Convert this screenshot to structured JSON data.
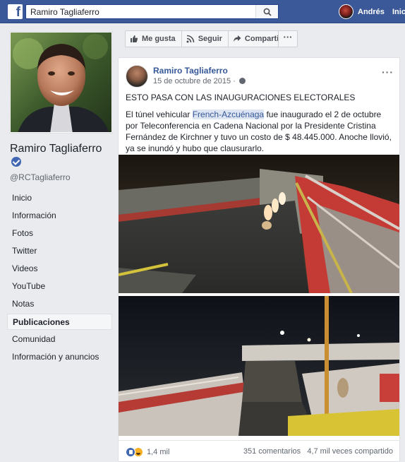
{
  "topbar": {
    "logo": "f",
    "search_value": "Ramiro Tagliaferro",
    "search_icon": "search-icon",
    "user_name": "Andrés",
    "home_label": "Inicio"
  },
  "page": {
    "name": "Ramiro Tagliaferro",
    "handle": "@RCTagliaferro",
    "nav": [
      "Inicio",
      "Información",
      "Fotos",
      "Twitter",
      "Videos",
      "YouTube",
      "Notas",
      "Publicaciones",
      "Comunidad",
      "Información y anuncios"
    ],
    "active_nav": "Publicaciones"
  },
  "actions": {
    "like": "Me gusta",
    "follow": "Seguir",
    "share": "Compartir",
    "more": "···"
  },
  "post": {
    "author": "Ramiro Tagliaferro",
    "date": "15 de octubre de 2015 ·",
    "menu": "···",
    "headline": "ESTO PASA CON LAS INAUGURACIONES ELECTORALES",
    "body_before": "El túnel vehicular ",
    "body_link": "French-Azcuénaga",
    "body_after": " fue inaugurado el 2 de octubre por Teleconferencia en Cadena Nacional por la Presidente Cristina Fernández de Kirchner y tuvo un costo de $ 48.445.000. Anoche llovió, ya se inundó y hubo que clausurarlo.",
    "reactions_count": "1,4 mil",
    "comments": "351 comentarios",
    "shares": "4,7 mil veces compartido"
  },
  "colors": {
    "brand": "#3b5998",
    "link": "#365899",
    "background": "#e9ebee"
  }
}
